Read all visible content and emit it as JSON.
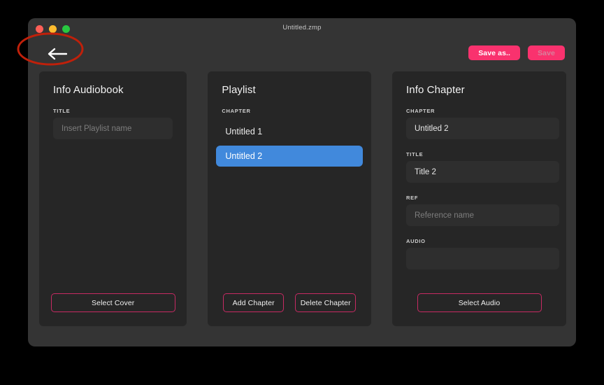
{
  "window": {
    "title": "Untitled.zmp",
    "traffic_lights": [
      {
        "name": "close-button",
        "color": "#ff5f57"
      },
      {
        "name": "minimize-button",
        "color": "#febc2e"
      },
      {
        "name": "maximize-button",
        "color": "#28c840"
      }
    ]
  },
  "toolbar": {
    "back_icon": "arrow-left-icon",
    "save_as_label": "Save as..",
    "save_label": "Save",
    "save_enabled": false,
    "accent_color": "#f9326e"
  },
  "annotation": {
    "shape": "ellipse",
    "target": "back-button",
    "color": "#c0200a"
  },
  "panels": {
    "info_audiobook": {
      "title": "Info Audiobook",
      "title_label": "TITLE",
      "title_value": "",
      "title_placeholder": "Insert Playlist name",
      "select_cover_label": "Select Cover"
    },
    "playlist": {
      "title": "Playlist",
      "chapter_label": "CHAPTER",
      "chapters": [
        {
          "label": "Untitled 1",
          "selected": false
        },
        {
          "label": "Untitled 2",
          "selected": true
        }
      ],
      "selected_color": "#4189dc",
      "add_chapter_label": "Add Chapter",
      "delete_chapter_label": "Delete Chapter"
    },
    "info_chapter": {
      "title": "Info Chapter",
      "chapter_label": "CHAPTER",
      "chapter_value": "Untitled 2",
      "title_label": "TITLE",
      "title_value": "Title 2",
      "ref_label": "REF",
      "ref_value": "",
      "ref_placeholder": "Reference name",
      "audio_label": "AUDIO",
      "audio_value": "",
      "select_audio_label": "Select Audio"
    }
  }
}
